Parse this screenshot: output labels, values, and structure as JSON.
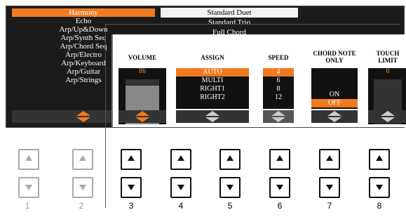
{
  "screen": {
    "type_list": [
      "Harmony",
      "Echo",
      "Arp/Up&Down",
      "Arp/Synth Seq",
      "Arp/Chord Seq",
      "Arp/Electro",
      "Arp/Keyboard",
      "Arp/Guitar",
      "Arp/Strings"
    ],
    "type_selected": "Harmony",
    "top_list": [
      "Standard Duet",
      "Standard Trio",
      "Full Chord"
    ]
  },
  "panel": {
    "volume": {
      "title": "VOLUME",
      "value": "86",
      "level": 0.86
    },
    "assign": {
      "title": "ASSIGN",
      "options": [
        "AUTO",
        "MULTI",
        "RIGHT1",
        "RIGHT2"
      ],
      "selected": "AUTO"
    },
    "speed": {
      "title": "SPEED",
      "options": [
        "4",
        "6",
        "8",
        "12"
      ],
      "selected": "4"
    },
    "chord_note_only": {
      "title": "CHORD NOTE ONLY",
      "options": [
        "ON",
        "OFF"
      ],
      "selected": "OFF"
    },
    "touch_limit": {
      "title": "TOUCH LIMIT",
      "value": "0"
    }
  },
  "buttons": [
    {
      "label": "1",
      "active": false
    },
    {
      "label": "2",
      "active": false
    },
    {
      "label": "3",
      "active": true
    },
    {
      "label": "4",
      "active": true
    },
    {
      "label": "5",
      "active": true
    },
    {
      "label": "6",
      "active": true
    },
    {
      "label": "7",
      "active": true
    },
    {
      "label": "8",
      "active": true
    }
  ],
  "colors": {
    "accent": "#f07a20",
    "screen_bg": "#1b1b1b"
  }
}
